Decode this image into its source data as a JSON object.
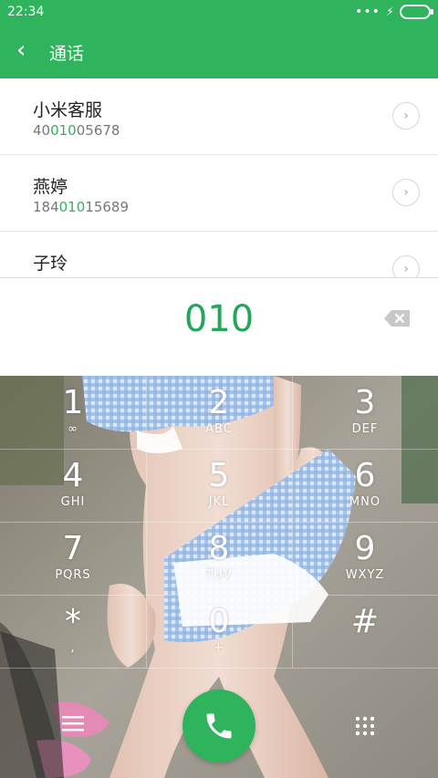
{
  "status_bar": {
    "time": "22:34",
    "icons": [
      "dots-icon",
      "charging-icon",
      "battery-icon"
    ]
  },
  "header": {
    "title": "通话"
  },
  "contacts": [
    {
      "name": "小米客服",
      "number_pre": "40",
      "number_match": "010",
      "number_post": "05678"
    },
    {
      "name": "燕婷",
      "number_pre": "184",
      "number_match": "010",
      "number_post": "15689"
    },
    {
      "name": "子玲",
      "number_pre": "",
      "number_match": "",
      "number_post": ""
    }
  ],
  "dialer": {
    "number": "010"
  },
  "keys": [
    {
      "digit": "1",
      "letters": "∞"
    },
    {
      "digit": "2",
      "letters": "ABC"
    },
    {
      "digit": "3",
      "letters": "DEF"
    },
    {
      "digit": "4",
      "letters": "GHI"
    },
    {
      "digit": "5",
      "letters": "JKL"
    },
    {
      "digit": "6",
      "letters": "MNO"
    },
    {
      "digit": "7",
      "letters": "PQRS"
    },
    {
      "digit": "8",
      "letters": "TUV"
    },
    {
      "digit": "9",
      "letters": "WXYZ"
    },
    {
      "digit": "*",
      "letters": ","
    },
    {
      "digit": "0",
      "letters": "+"
    },
    {
      "digit": "#",
      "letters": ""
    }
  ],
  "colors": {
    "accent": "#2fb35c",
    "number": "#22a65a"
  }
}
